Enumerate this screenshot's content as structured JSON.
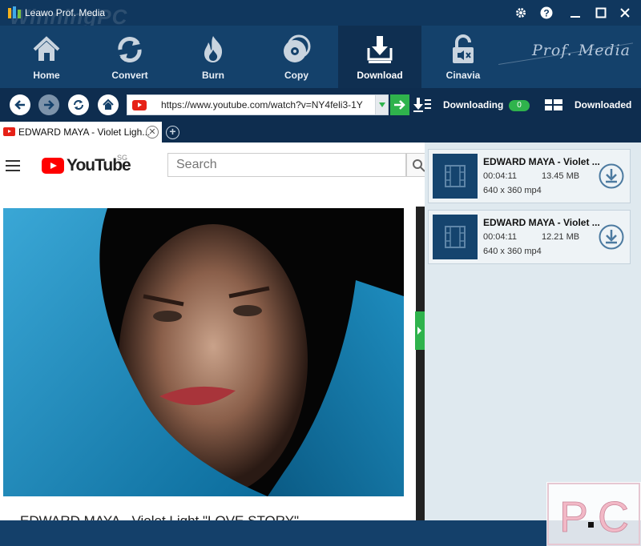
{
  "app": {
    "title": "Leawo Prof. Media",
    "watermark": "WinningPC",
    "brand": "Prof. Media"
  },
  "window_controls": [
    {
      "name": "settings-icon"
    },
    {
      "name": "help-icon"
    },
    {
      "name": "minimize-icon"
    },
    {
      "name": "maximize-icon"
    },
    {
      "name": "close-icon"
    }
  ],
  "ribbon": {
    "tabs": [
      {
        "label": "Home",
        "icon": "home-icon"
      },
      {
        "label": "Convert",
        "icon": "convert-icon"
      },
      {
        "label": "Burn",
        "icon": "burn-icon"
      },
      {
        "label": "Copy",
        "icon": "copy-icon"
      },
      {
        "label": "Download",
        "icon": "download-icon",
        "active": true
      },
      {
        "label": "Cinavia",
        "icon": "cinavia-icon"
      }
    ]
  },
  "nav": {
    "url": "https://www.youtube.com/watch?v=NY4feli3-1Y",
    "downloading_label": "Downloading",
    "downloading_count": "0",
    "downloaded_label": "Downloaded"
  },
  "browser_tab": {
    "title": "EDWARD MAYA - Violet Ligh..."
  },
  "youtube": {
    "logo_text": "YouTube",
    "region": "SG",
    "search_placeholder": "Search",
    "video_title": "EDWARD MAYA - Violet Light \"LOVE STORY\""
  },
  "downloads": [
    {
      "title": "EDWARD MAYA - Violet ...",
      "duration": "00:04:11",
      "size": "13.45 MB",
      "format": "640 x 360 mp4"
    },
    {
      "title": "EDWARD MAYA - Violet ...",
      "duration": "00:04:11",
      "size": "12.21 MB",
      "format": "640 x 360 mp4"
    }
  ],
  "colors": {
    "accent_green": "#2fb34c",
    "header_blue": "#14416b",
    "active_tab": "#0f2f51",
    "youtube_red": "#ff0000"
  },
  "corner_watermark": "PC"
}
